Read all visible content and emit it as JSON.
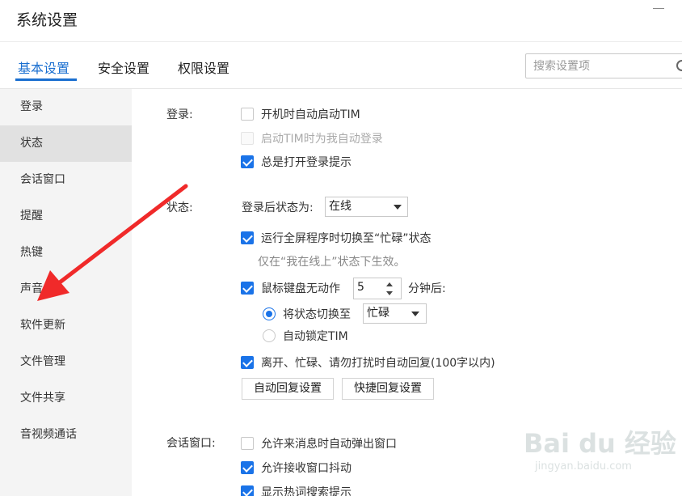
{
  "window": {
    "title": "系统设置"
  },
  "tabs": [
    {
      "label": "基本设置",
      "active": true
    },
    {
      "label": "安全设置",
      "active": false
    },
    {
      "label": "权限设置",
      "active": false
    }
  ],
  "search": {
    "placeholder": "搜索设置项",
    "value": ""
  },
  "sidebar": {
    "items": [
      {
        "label": "登录",
        "active": false
      },
      {
        "label": "状态",
        "active": true
      },
      {
        "label": "会话窗口",
        "active": false
      },
      {
        "label": "提醒",
        "active": false
      },
      {
        "label": "热键",
        "active": false
      },
      {
        "label": "声音",
        "active": false
      },
      {
        "label": "软件更新",
        "active": false
      },
      {
        "label": "文件管理",
        "active": false
      },
      {
        "label": "文件共享",
        "active": false
      },
      {
        "label": "音视频通话",
        "active": false
      }
    ]
  },
  "login": {
    "label": "登录:",
    "options": [
      {
        "label": "开机时自动启动TIM",
        "checked": false,
        "disabled": false
      },
      {
        "label": "启动TIM时为我自动登录",
        "checked": false,
        "disabled": true
      },
      {
        "label": "总是打开登录提示",
        "checked": true,
        "disabled": false
      }
    ]
  },
  "status": {
    "label": "状态:",
    "after_login_label": "登录后状态为:",
    "after_login_value": "在线",
    "fullscreen_busy": {
      "label": "运行全屏程序时切换至“忙碌”状态",
      "checked": true
    },
    "fullscreen_hint": "仅在“我在线上”状态下生效。",
    "idle": {
      "label": "鼠标键盘无动作",
      "checked": true,
      "minutes": "5",
      "suffix": "分钟后:"
    },
    "switch_to": {
      "label": "将状态切换至",
      "checked": true,
      "value": "忙碌"
    },
    "auto_lock": {
      "label": "自动锁定TIM",
      "checked": false
    },
    "auto_reply": {
      "label": "离开、忙碌、请勿打扰时自动回复(100字以内)",
      "checked": true
    },
    "auto_reply_button": "自动回复设置",
    "quick_reply_button": "快捷回复设置"
  },
  "chat_window": {
    "label": "会话窗口:",
    "options": [
      {
        "label": "允许来消息时自动弹出窗口",
        "checked": false
      },
      {
        "label": "允许接收窗口抖动",
        "checked": true
      },
      {
        "label": "显示热词搜索提示",
        "checked": true
      }
    ]
  },
  "watermark": {
    "logo": "Bai du 经验",
    "url": "jingyan.baidu.com"
  },
  "colors": {
    "accent": "#1a6fd0",
    "checkbox": "#1a73e8",
    "annotation_arrow": "#f02a2a"
  }
}
